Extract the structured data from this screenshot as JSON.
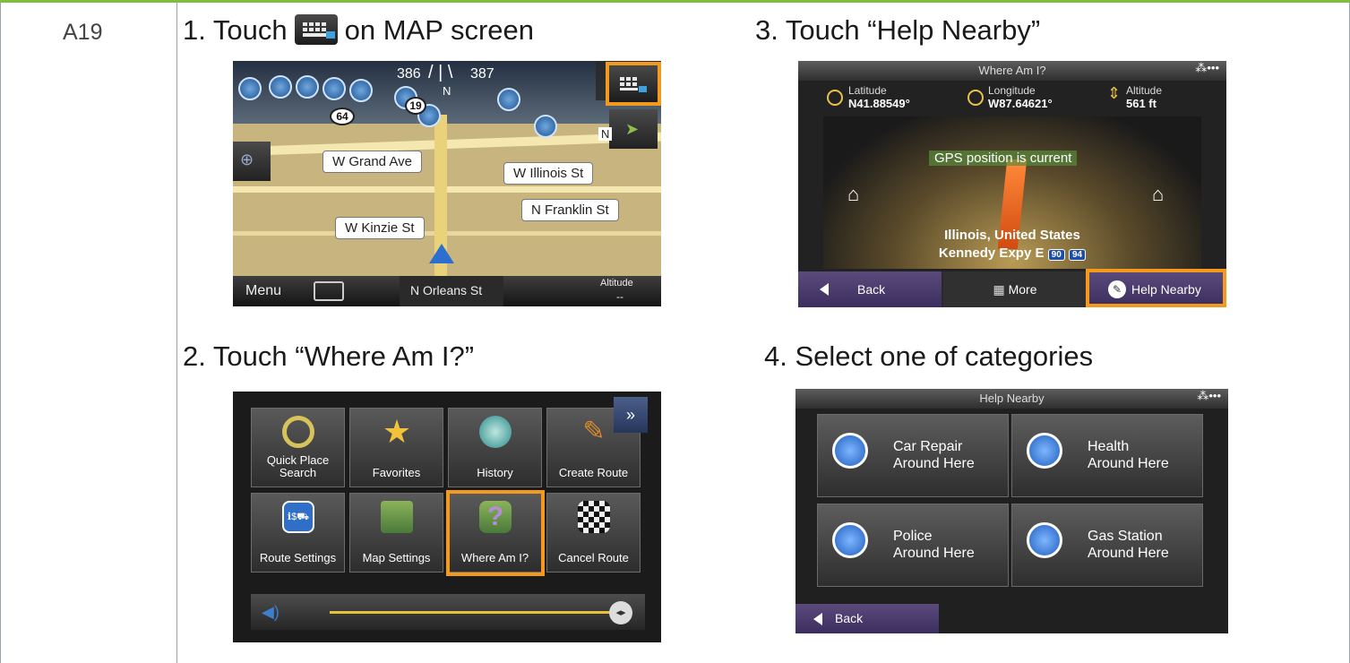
{
  "row": {
    "id": "A19"
  },
  "steps": {
    "s1": {
      "pre": "1.  Touch",
      "post": "on MAP screen"
    },
    "s2": {
      "text": "2.  Touch “Where Am I?”"
    },
    "s3": {
      "text": "3.  Touch “Help Nearby”"
    },
    "s4": {
      "text": "4.  Select one of categories"
    }
  },
  "map": {
    "heading_left": "386",
    "heading_right": "387",
    "heading_dir": "N",
    "streets": [
      "W Grand Ave",
      "W Illinois St",
      "N Franklin St",
      "W Kinzie St"
    ],
    "shields": [
      "64",
      "19"
    ],
    "side_tag": "N",
    "bottom_menu": "Menu",
    "bottom_street": "N Orleans St",
    "altitude_label": "Altitude",
    "altitude_value": "--"
  },
  "where": {
    "title": "Where Am I?",
    "status": "⁂•••",
    "lat_label": "Latitude",
    "lat": "N41.88549°",
    "lon_label": "Longitude",
    "lon": "W87.64621°",
    "alt_label": "Altitude",
    "alt": "561 ft",
    "gps": "GPS position is current",
    "place1": "Illinois, United States",
    "place2": "Kennedy Expy E",
    "hw1": "90",
    "hw2": "94",
    "btn_back": "Back",
    "btn_more": "More",
    "btn_help": "Help Nearby"
  },
  "menu": {
    "tiles": [
      "Quick Place Search",
      "Favorites",
      "History",
      "Create Route",
      "Route Settings",
      "Map Settings",
      "Where Am I?",
      "Cancel Route"
    ],
    "route_icon_text": "ℹ$⛟"
  },
  "help": {
    "title": "Help Nearby",
    "cats": [
      {
        "name": "Car Repair",
        "sub": "Around Here"
      },
      {
        "name": "Health",
        "sub": "Around Here"
      },
      {
        "name": "Police",
        "sub": "Around Here"
      },
      {
        "name": "Gas Station",
        "sub": "Around Here"
      }
    ],
    "back": "Back"
  },
  "colors": {
    "highlight": "#f39a1e",
    "accent_rule": "#7fbf3f"
  }
}
